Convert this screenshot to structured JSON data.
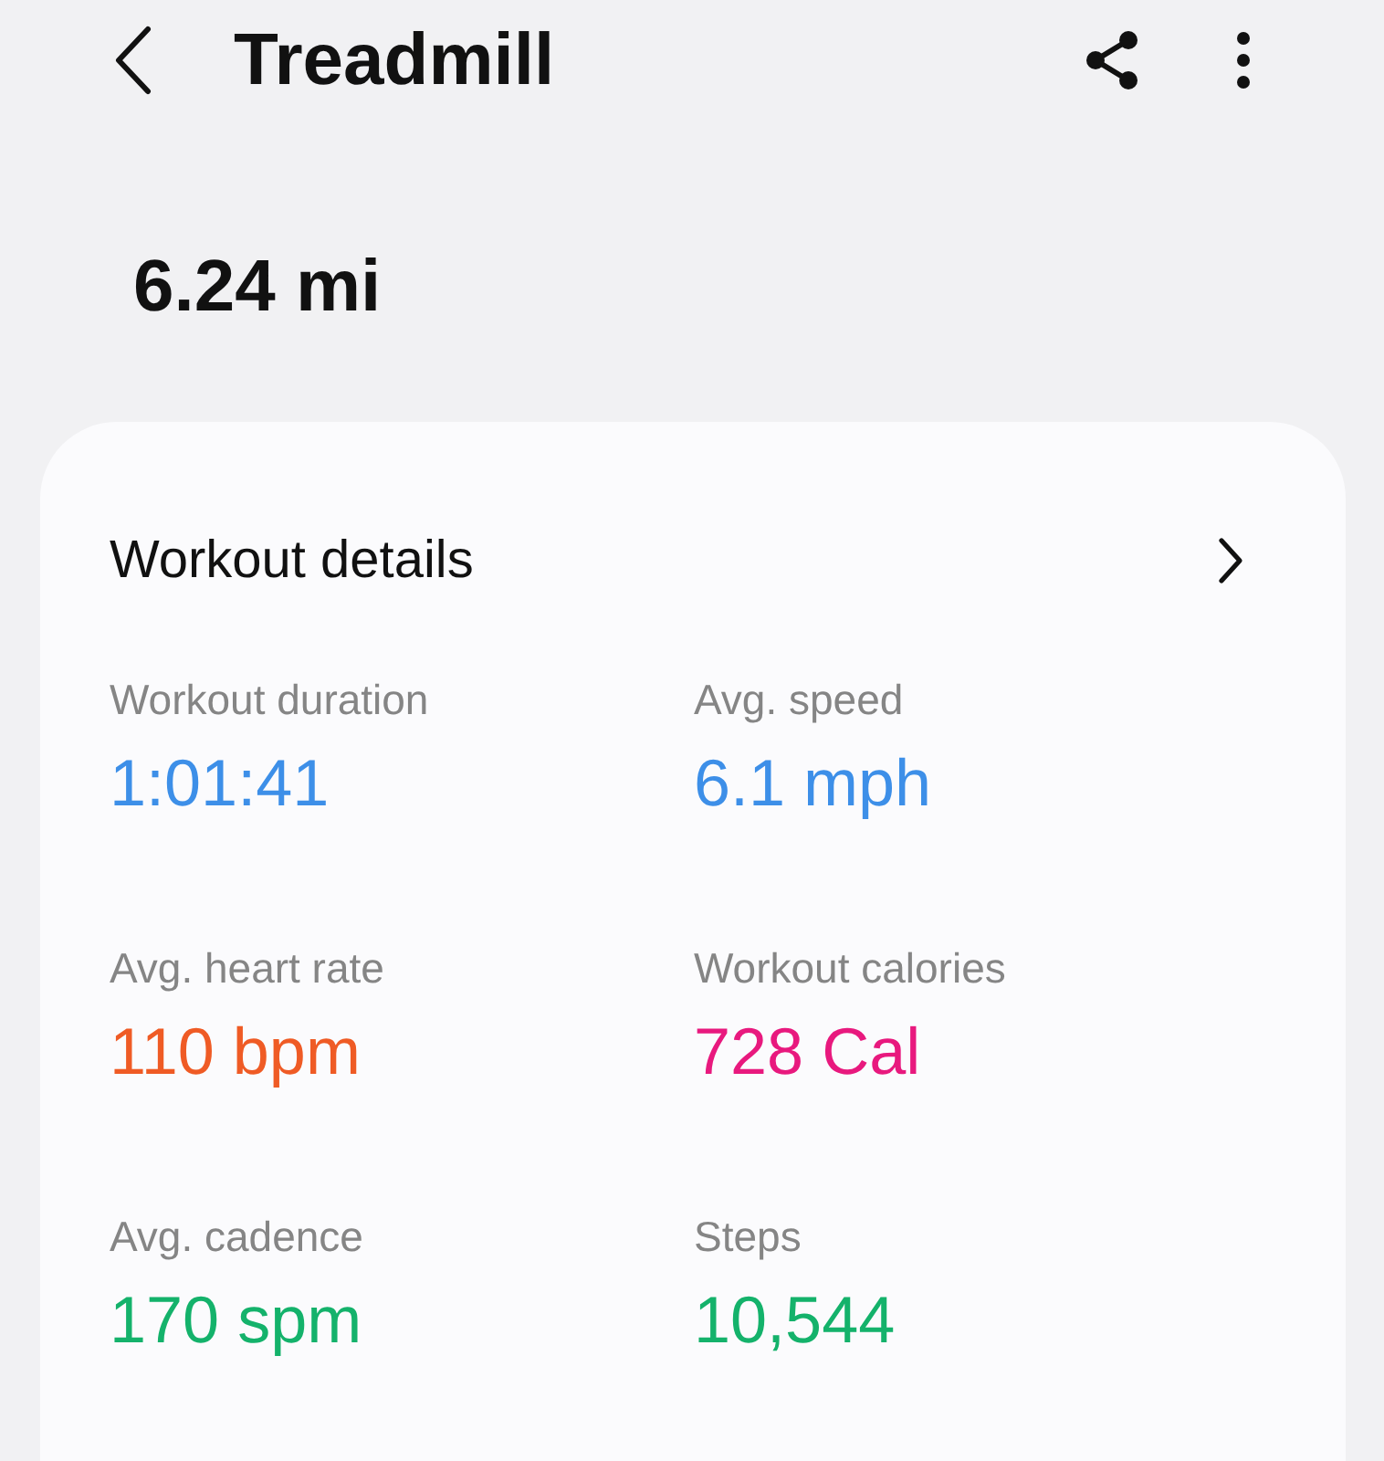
{
  "header": {
    "title": "Treadmill"
  },
  "distance": "6.24 mi",
  "card": {
    "title": "Workout details",
    "metrics": [
      {
        "label": "Workout duration",
        "value": "1:01:41",
        "color": "#3d8fe8"
      },
      {
        "label": "Avg. speed",
        "value": "6.1 mph",
        "color": "#3d8fe8"
      },
      {
        "label": "Avg. heart rate",
        "value": "110 bpm",
        "color": "#ef5b25"
      },
      {
        "label": "Workout calories",
        "value": "728 Cal",
        "color": "#e8197e"
      },
      {
        "label": "Avg. cadence",
        "value": "170 spm",
        "color": "#14b26b"
      },
      {
        "label": "Steps",
        "value": "10,544",
        "color": "#14b26b"
      }
    ]
  }
}
